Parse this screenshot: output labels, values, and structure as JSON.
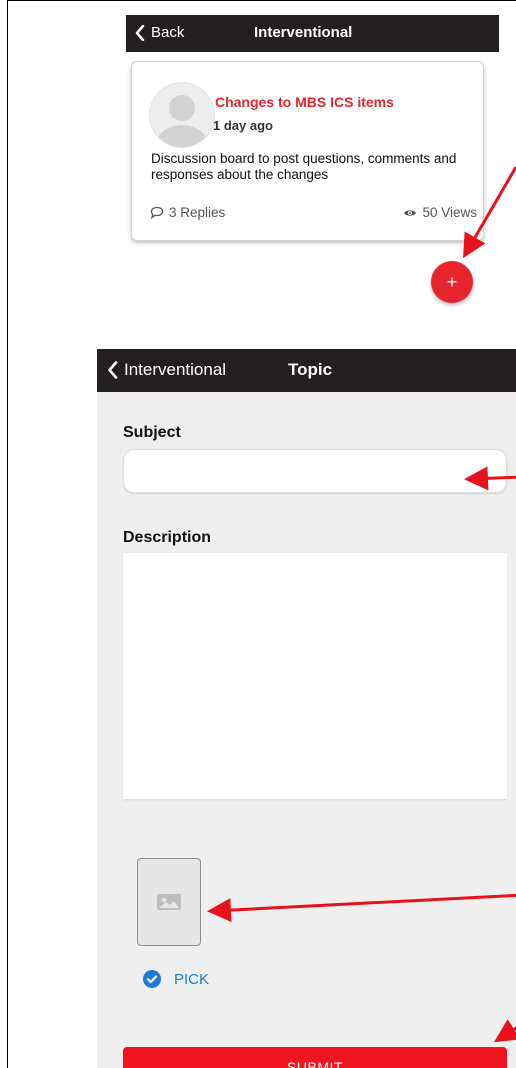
{
  "screen1": {
    "nav": {
      "back_label": "Back",
      "title": "Interventional"
    },
    "card": {
      "title": "Changes to MBS ICS items",
      "time": "1 day ago",
      "description": "Discussion board to post questions, comments and responses about the changes",
      "replies": "3 Replies",
      "views": "50 Views"
    },
    "fab_label": "+"
  },
  "screen2": {
    "nav": {
      "back_label": "Interventional",
      "title": "Topic"
    },
    "form": {
      "subject_label": "Subject",
      "subject_value": "",
      "description_label": "Description",
      "description_value": "",
      "pick_label": "PICK",
      "submit_label": "SUBMIT"
    }
  },
  "colors": {
    "accent_red": "#e8242c",
    "nav_bg": "#231f20",
    "link_blue": "#1e7bd6",
    "form_bg": "#efefef"
  },
  "icons": [
    "chevron-left-icon",
    "comment-icon",
    "eye-icon",
    "plus-icon",
    "image-icon",
    "check-circle-icon"
  ]
}
